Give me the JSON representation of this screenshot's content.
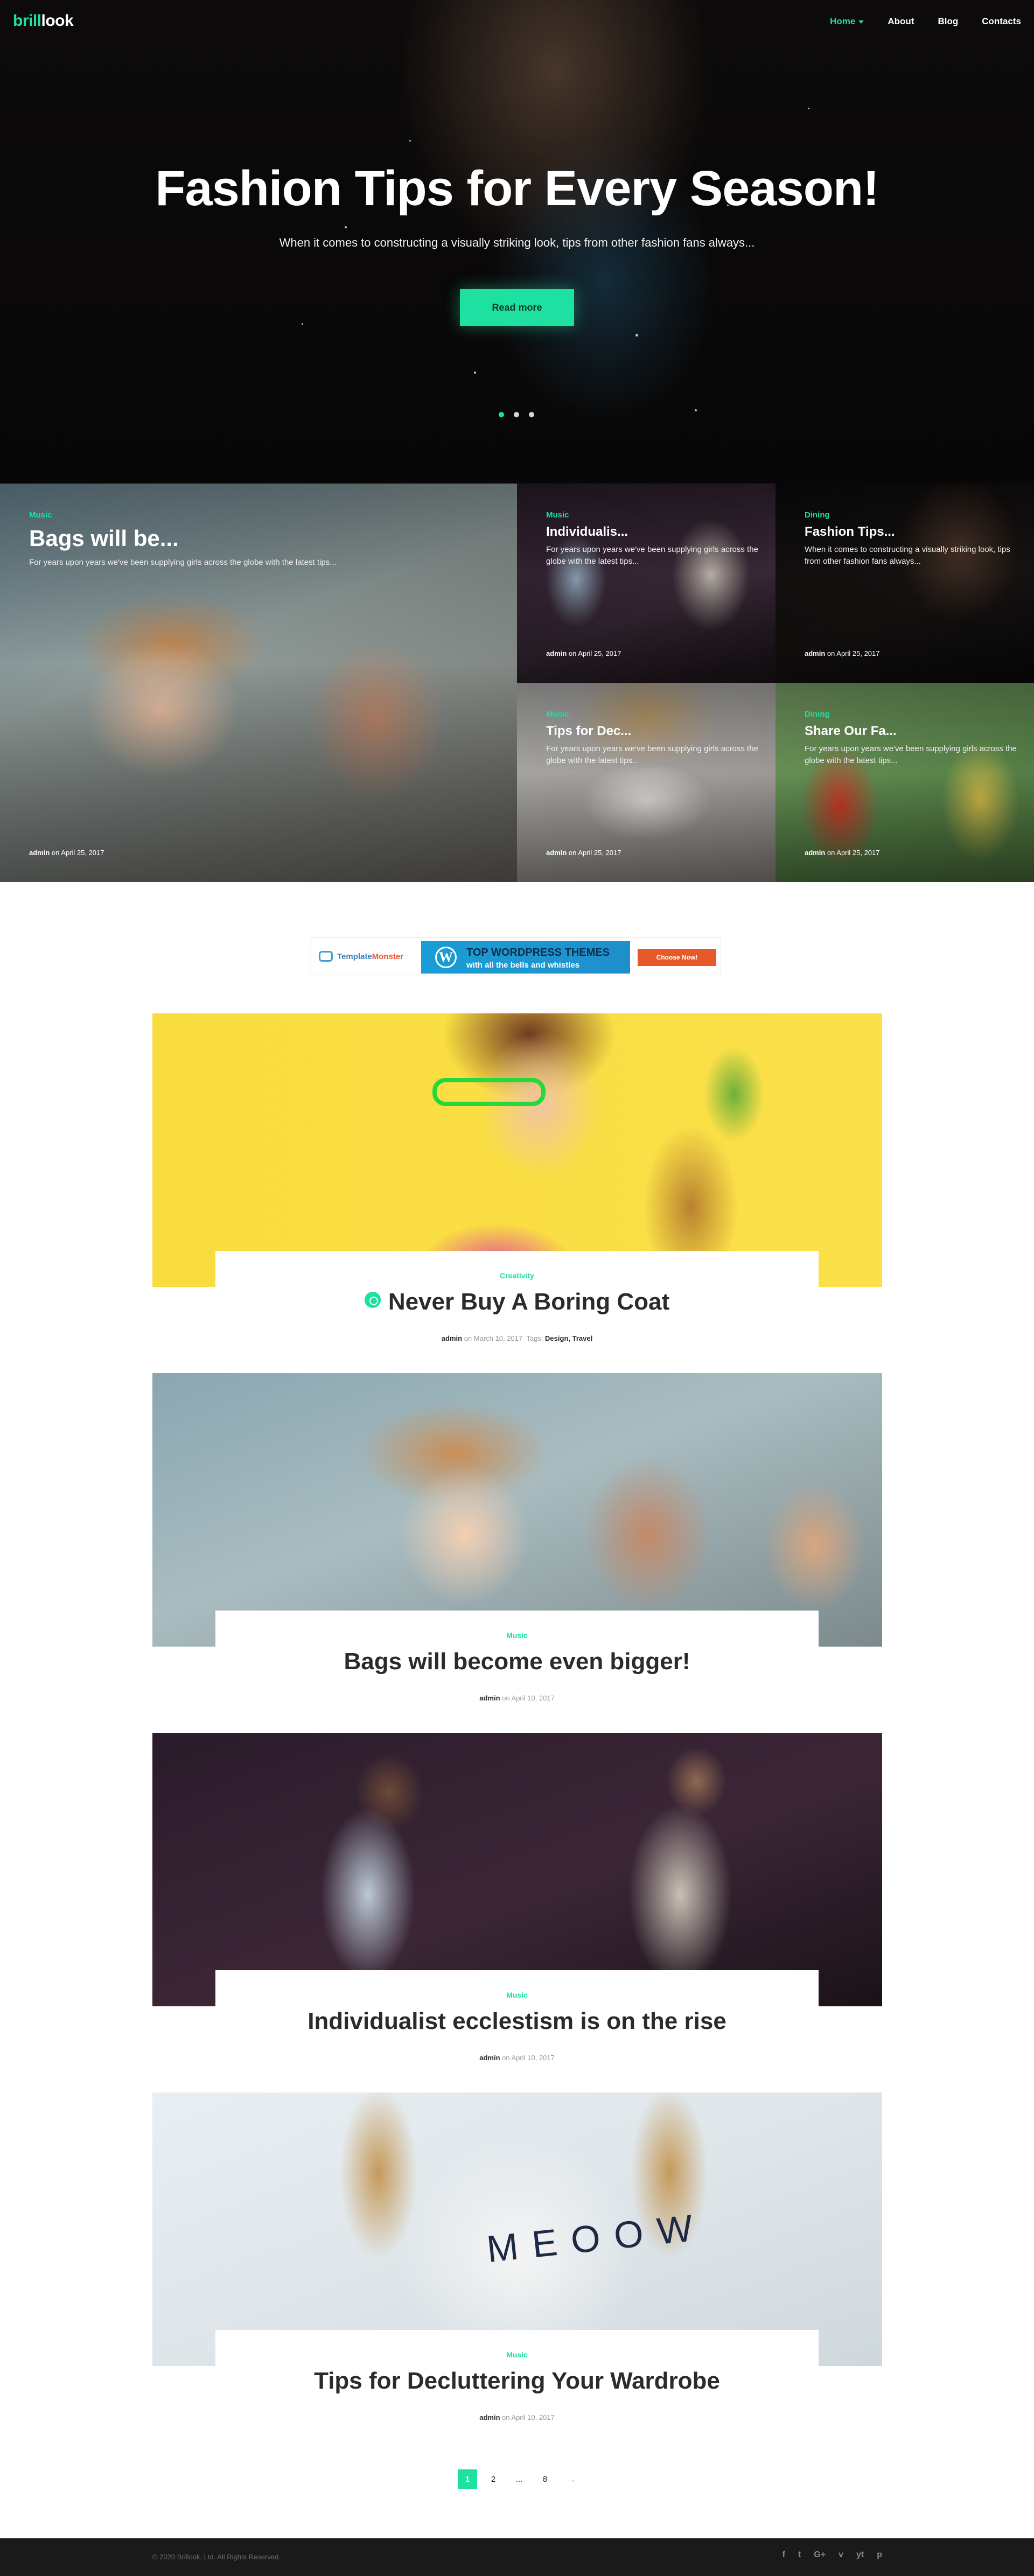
{
  "brand": {
    "part1": "brill",
    "part2": "look"
  },
  "nav": {
    "items": [
      "Home",
      "About",
      "Blog",
      "Contacts"
    ],
    "active": "Home"
  },
  "hero": {
    "title": "Fashion Tips for Every Season!",
    "subtitle": "When it comes to constructing a visually striking look, tips from other fashion fans always...",
    "button": "Read more",
    "slides": 3,
    "active_slide": 1
  },
  "featured": [
    {
      "category": "Music",
      "title": "Bags will be...",
      "excerpt": "For years upon years we've been supplying girls across the globe with the latest tips...",
      "author": "admin",
      "date": "on April 25, 2017"
    },
    {
      "category": "Music",
      "title": "Individualis...",
      "excerpt": "For years upon years we've been supplying girls across the globe with the latest tips...",
      "author": "admin",
      "date": "on April 25, 2017"
    },
    {
      "category": "Dining",
      "title": "Fashion Tips...",
      "excerpt": "When it comes to constructing a visually striking look, tips from other fashion fans always...",
      "author": "admin",
      "date": "on April 25, 2017"
    },
    {
      "category": "Music",
      "title": "Tips for Dec...",
      "excerpt": "For years upon years we've been supplying girls across the globe with the latest tips...",
      "author": "admin",
      "date": "on April 25, 2017"
    },
    {
      "category": "Dining",
      "title": "Share Our Fa...",
      "excerpt": "For years upon years we've been supplying girls across the globe with the latest tips...",
      "author": "admin",
      "date": "on April 25, 2017"
    }
  ],
  "ad": {
    "brand_a": "Template",
    "brand_b": "Monster",
    "headline": "TOP WORDPRESS THEMES",
    "subline": "with all the bells and whistles",
    "cta": "Choose Now!"
  },
  "posts": [
    {
      "category": "Creativity",
      "title": "Never Buy A Boring Coat",
      "author": "admin",
      "date": "on March 10, 2017",
      "tags_label": "Tags:",
      "tags": "Design, Travel",
      "sticky": true
    },
    {
      "category": "Music",
      "title": "Bags will become even bigger!",
      "author": "admin",
      "date": "on April 10, 2017"
    },
    {
      "category": "Music",
      "title": "Individualist ecclestism is on the rise",
      "author": "admin",
      "date": "on April 10, 2017"
    },
    {
      "category": "Music",
      "title": "Tips for Decluttering Your Wardrobe",
      "author": "admin",
      "date": "on April 10, 2017"
    }
  ],
  "pagination": {
    "pages": [
      "1",
      "2",
      "...",
      "8"
    ],
    "current": "1",
    "next": "→"
  },
  "footer": {
    "copyright": "© 2020 Brillook, Ltd. All Rights Reserved.",
    "social": [
      "f",
      "t",
      "G+",
      "v",
      "yt",
      "p"
    ],
    "social_icons": [
      "facebook-icon",
      "twitter-icon",
      "google-plus-icon",
      "vimeo-icon",
      "youtube-icon",
      "pinterest-icon"
    ]
  },
  "colors": {
    "accent": "#1ee0a0",
    "footer_bg": "#1a1a1a",
    "ad_button": "#e65a2a"
  }
}
